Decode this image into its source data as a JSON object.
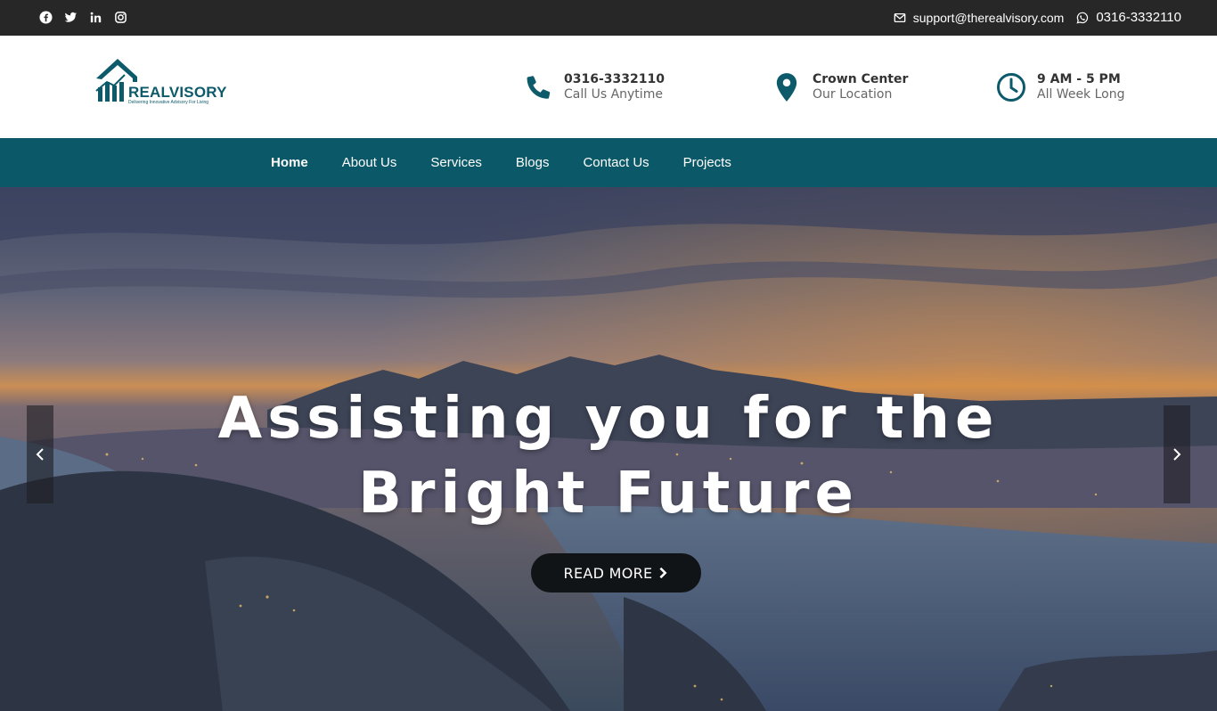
{
  "topbar": {
    "social_icons": [
      "facebook-icon",
      "twitter-icon",
      "linkedin-icon",
      "instagram-icon"
    ],
    "email": "support@therealvisory.com",
    "phone": "0316-3332110"
  },
  "header": {
    "logo_name": "REALVISORY",
    "logo_tagline": "Delivering Innovative Advisory For Living",
    "phone": {
      "title": "0316-3332110",
      "subtitle": "Call Us Anytime"
    },
    "location": {
      "title": "Crown Center",
      "subtitle": "Our Location"
    },
    "hours": {
      "title": "9 AM - 5 PM",
      "subtitle": "All Week Long"
    }
  },
  "nav": {
    "items": [
      "Home",
      "About Us",
      "Services",
      "Blogs",
      "Contact Us",
      "Projects"
    ],
    "active": "Home"
  },
  "hero": {
    "title_line1": "Assisting you for the",
    "title_line2": "Bright Future",
    "button_label": "READ MORE"
  },
  "colors": {
    "topbar_bg": "#272727",
    "brand_teal": "#0a5868",
    "button_bg": "#111417"
  }
}
